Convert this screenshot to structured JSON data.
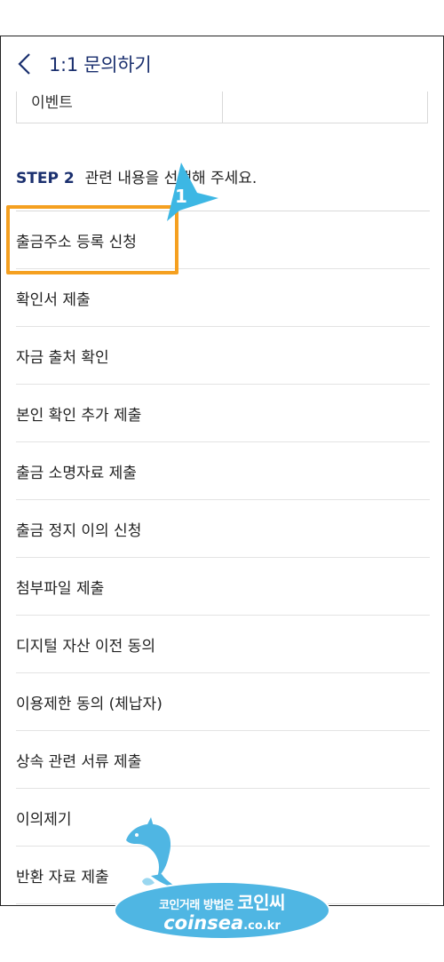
{
  "header": {
    "title": "1:1 문의하기"
  },
  "previous_selection": {
    "label": "이벤트"
  },
  "step": {
    "label": "STEP 2",
    "description": "관련 내용을 선택해 주세요."
  },
  "annotation": {
    "number": "1"
  },
  "items": [
    "출금주소 등록 신청",
    "확인서 제출",
    "자금 출처 확인",
    "본인 확인 추가 제출",
    "출금 소명자료 제출",
    "출금 정지 이의 신청",
    "첨부파일 제출",
    "디지털 자산 이전 동의",
    "이용제한 동의 (체납자)",
    "상속 관련 서류 제출",
    "이의제기",
    "반환 자료 제출"
  ],
  "watermark": {
    "tagline": "코인거래 방법은",
    "brand": "코인씨",
    "domain": "coinsea",
    "tld": ".co.kr"
  },
  "colors": {
    "accent": "#1a2f6e",
    "highlight": "#f5a020",
    "arrow": "#3db7e4"
  }
}
